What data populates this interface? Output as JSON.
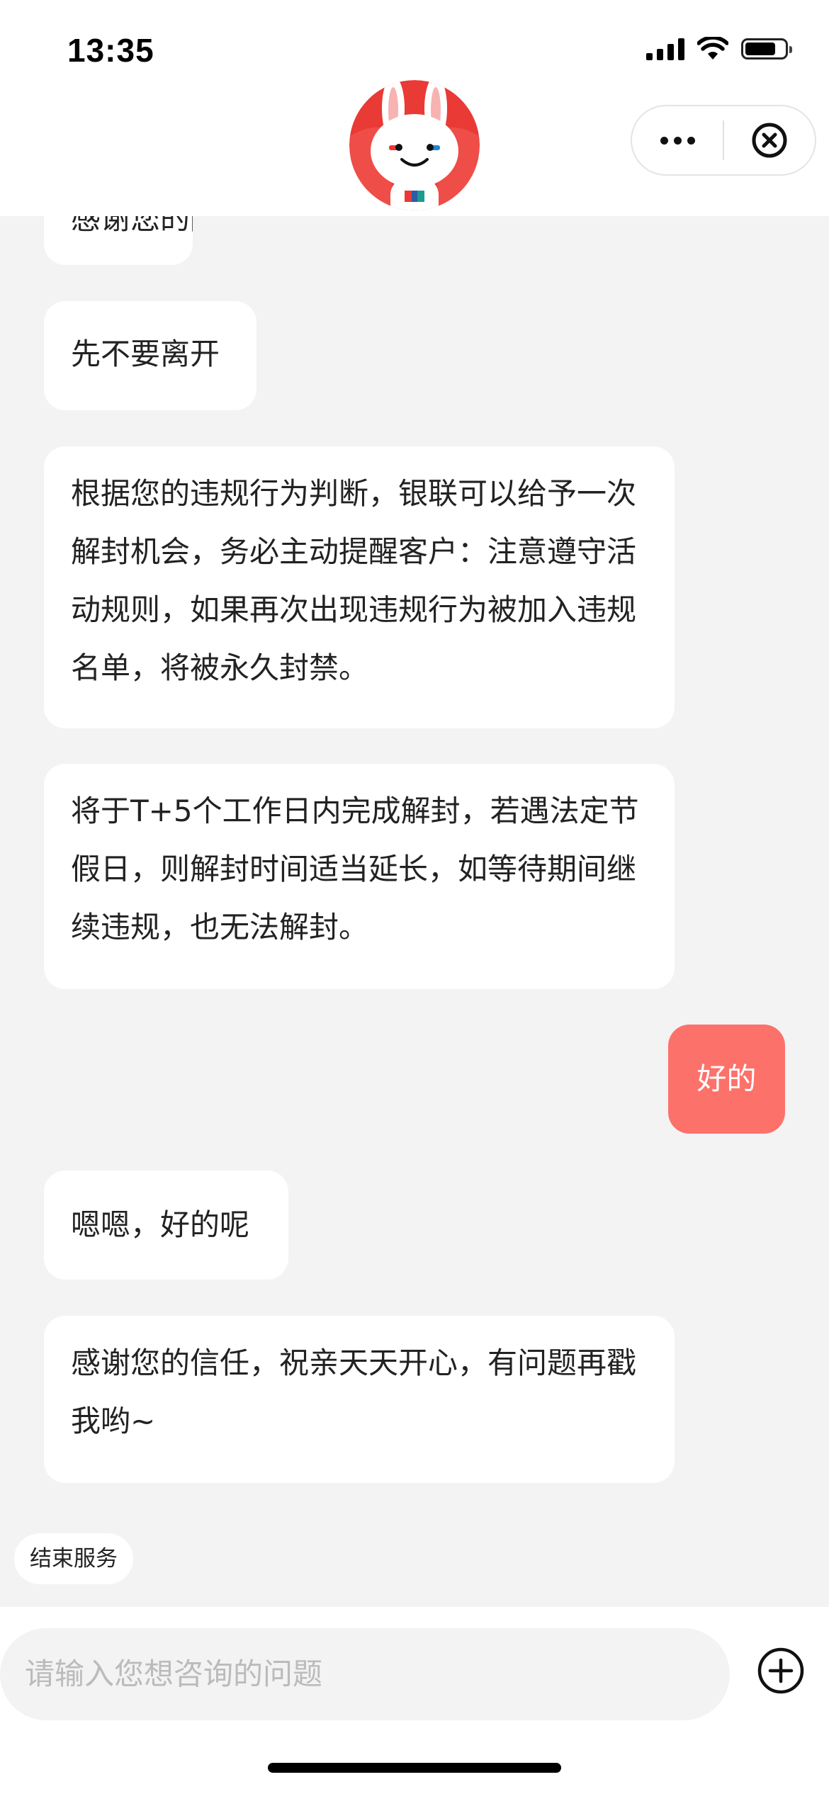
{
  "status_bar": {
    "time": "13:35"
  },
  "header": {
    "avatar_icon": "rabbit-mascot-icon",
    "more_icon": "ellipsis-icon",
    "close_icon": "close-circle-icon"
  },
  "messages": [
    {
      "from": "agent",
      "text": "感谢您的耐心等待"
    },
    {
      "from": "agent",
      "text": "先不要离开"
    },
    {
      "from": "agent",
      "text": "根据您的违规行为判断，银联可以给予一次解封机会，务必主动提醒客户：注意遵守活动规则，如果再次出现违规行为被加入违规名单，将被永久封禁。"
    },
    {
      "from": "agent",
      "text": "将于T+5个工作日内完成解封，若遇法定节假日，则解封时间适当延长，如等待期间继续违规，也无法解封。"
    },
    {
      "from": "user",
      "text": "好的"
    },
    {
      "from": "agent",
      "text": "嗯嗯，好的呢"
    },
    {
      "from": "agent",
      "text": "感谢您的信任，祝亲天天开心，有问题再戳我哟~"
    }
  ],
  "end_service_label": "结束服务",
  "input": {
    "placeholder": "请输入您想咨询的问题",
    "add_icon": "plus-circle-icon"
  },
  "colors": {
    "user_bubble": "#fd716b",
    "background": "#f3f3f3",
    "brand_red": "#e93a35"
  }
}
